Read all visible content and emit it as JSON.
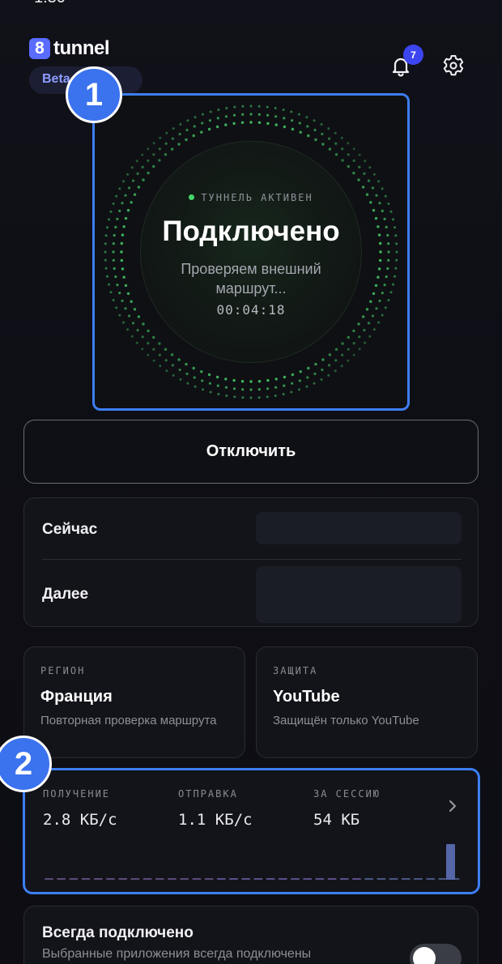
{
  "header": {
    "logo_mark": "8",
    "logo_word": "tunnel",
    "beta_label": "Beta 1.0.8",
    "notifications_count": "7"
  },
  "hero": {
    "status": "ТУННЕЛЬ АКТИВЕН",
    "title": "Подключено",
    "subtitle": "Проверяем внешний маршрут...",
    "timer": "00:04:18",
    "accent_color": "#47d56a"
  },
  "callouts": {
    "one": "1",
    "two": "2"
  },
  "disconnect_label": "Отключить",
  "schedule": {
    "now_label": "Сейчас",
    "next_label": "Далее"
  },
  "region": {
    "caption": "РЕГИОН",
    "value": "Франция",
    "description": "Повторная проверка маршрута"
  },
  "protection": {
    "caption": "ЗАЩИТА",
    "value": "YouTube",
    "description": "Защищён только YouTube"
  },
  "traffic": {
    "download_caption": "ПОЛУЧЕНИЕ",
    "download_value": "2.8 КБ/с",
    "upload_caption": "ОТПРАВКА",
    "upload_value": "1.1 КБ/с",
    "session_caption": "ЗА СЕССИЮ",
    "session_value": "54 КБ"
  },
  "always_on": {
    "title": "Всегда подключено",
    "description": "Выбранные приложения всегда подключены",
    "enabled": false
  },
  "colors": {
    "accent_blue": "#3d7ef2",
    "brand": "#5a6cff",
    "connected_green": "#47d56a"
  }
}
